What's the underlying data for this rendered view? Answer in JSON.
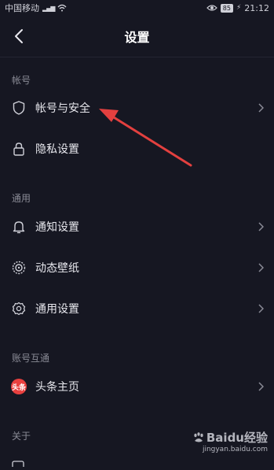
{
  "status_bar": {
    "carrier": "中国移动",
    "signal": "4G",
    "battery": "85",
    "time": "21:12"
  },
  "header": {
    "title": "设置"
  },
  "sections": [
    {
      "title": "帐号",
      "items": [
        {
          "label": "帐号与安全",
          "icon": "shield-icon"
        },
        {
          "label": "隐私设置",
          "icon": "lock-icon"
        }
      ]
    },
    {
      "title": "通用",
      "items": [
        {
          "label": "通知设置",
          "icon": "bell-icon"
        },
        {
          "label": "动态壁纸",
          "icon": "live-wallpaper-icon"
        },
        {
          "label": "通用设置",
          "icon": "gear-icon"
        }
      ]
    },
    {
      "title": "账号互通",
      "items": [
        {
          "label": "头条主页",
          "icon": "toutiao-logo",
          "logo_text": "头条"
        }
      ]
    },
    {
      "title": "关于",
      "items": []
    }
  ],
  "watermark": {
    "brand": "Baidu经验",
    "url": "jingyan.baidu.com"
  },
  "colors": {
    "background": "#161722",
    "annotation_arrow": "#e3403f",
    "toutiao_red": "#e8403f"
  }
}
